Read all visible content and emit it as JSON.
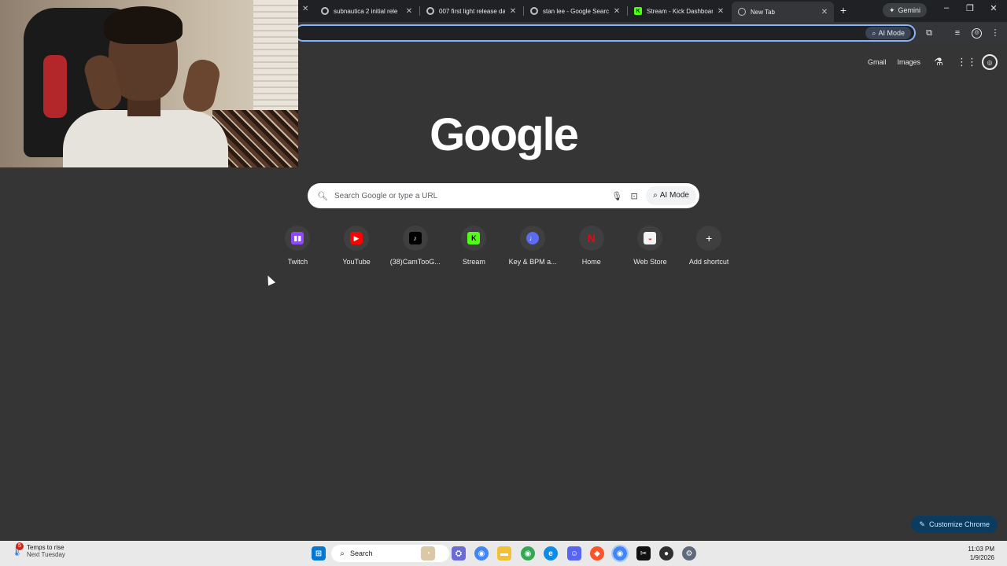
{
  "browser": {
    "tabs": [
      {
        "title": "subnautica 2 initial rele",
        "icon": "google-g-icon"
      },
      {
        "title": "007 first light release da",
        "icon": "google-g-icon"
      },
      {
        "title": "stan lee - Google Search",
        "icon": "google-g-icon"
      },
      {
        "title": "Stream - Kick Dashboar",
        "icon": "kick-icon"
      },
      {
        "title": "New Tab",
        "icon": "globe-icon",
        "active": true
      }
    ],
    "new_tab_symbol": "+",
    "gemini_label": "Gemini",
    "window_controls": {
      "minimize": "–",
      "restore": "❐",
      "close": "✕"
    },
    "omnibox": {
      "value": "",
      "ai_mode_label": "AI Mode"
    }
  },
  "newtab": {
    "top_links": {
      "gmail": "Gmail",
      "images": "Images"
    },
    "logo_text": "Google",
    "search_placeholder": "Search Google or type a URL",
    "ai_mode_label": "AI Mode",
    "shortcuts": [
      {
        "label": "Twitch",
        "icon": "twitch-icon",
        "color": "#9146ff"
      },
      {
        "label": "YouTube",
        "icon": "youtube-icon",
        "color": "#ff0000"
      },
      {
        "label": "(38)CamTooG...",
        "icon": "tiktok-icon",
        "color": "#000000"
      },
      {
        "label": "Stream",
        "icon": "kick-icon",
        "color": "#53fc18"
      },
      {
        "label": "Key & BPM a...",
        "icon": "note-icon",
        "color": "#5b6cf0"
      },
      {
        "label": "Home",
        "icon": "netflix-icon",
        "color": "#e50914"
      },
      {
        "label": "Web Store",
        "icon": "web-store-icon",
        "color": "#f1f3f4"
      },
      {
        "label": "Add shortcut",
        "icon": "plus-icon",
        "color": "#3f3f3f"
      }
    ],
    "customize_label": "Customize Chrome"
  },
  "taskbar": {
    "weather_title": "Temps to rise",
    "weather_subtitle": "Next Tuesday",
    "weather_badge": "5",
    "search_label": "Search",
    "time": "11:03 PM",
    "date": "1/9/2026"
  },
  "colors": {
    "page_bg": "#353535",
    "accent": "#8ab4f8",
    "customize_bg": "#0b3b5e"
  }
}
